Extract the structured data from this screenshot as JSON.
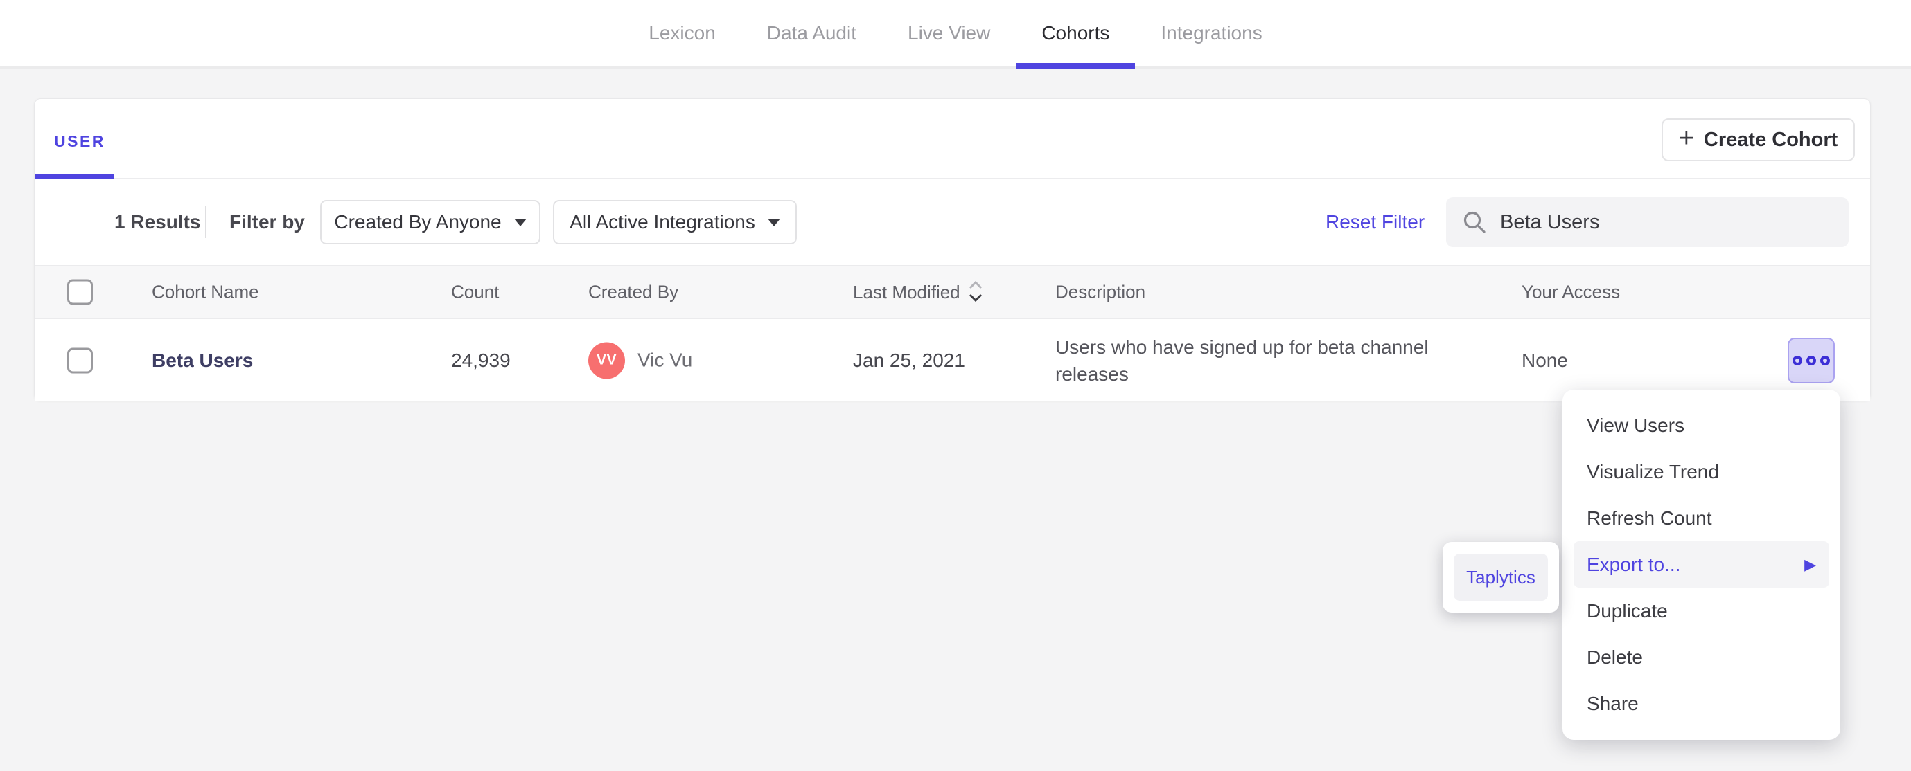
{
  "accent_color": "#4f44e0",
  "nav": {
    "items": [
      {
        "label": "Lexicon",
        "active": false
      },
      {
        "label": "Data Audit",
        "active": false
      },
      {
        "label": "Live View",
        "active": false
      },
      {
        "label": "Cohorts",
        "active": true
      },
      {
        "label": "Integrations",
        "active": false
      }
    ]
  },
  "card": {
    "tab_label": "USER",
    "create_button_label": "Create Cohort",
    "create_button_plus": "+",
    "filters": {
      "results_count": "1 Results",
      "filter_by_label": "Filter by",
      "dropdowns": [
        {
          "label": "Created By Anyone"
        },
        {
          "label": "All Active Integrations"
        }
      ],
      "reset_label": "Reset Filter",
      "search": {
        "icon": "search-icon",
        "value": "Beta Users"
      }
    },
    "table": {
      "columns": [
        "Cohort Name",
        "Count",
        "Created By",
        "Last Modified",
        "Description",
        "Your Access"
      ],
      "sorted_column": "Last Modified",
      "sort_state": "descending",
      "rows": [
        {
          "name": "Beta Users",
          "count": "24,939",
          "created_by": {
            "initials": "VV",
            "name": "Vic Vu",
            "avatar_color": "#f76f6f"
          },
          "last_modified": "Jan 25, 2021",
          "description": "Users who have signed up for beta channel releases",
          "your_access": "None",
          "more_icon": "more-horizontal-icon"
        }
      ]
    }
  },
  "context_menu": {
    "items": [
      {
        "label": "View Users",
        "highlighted": false
      },
      {
        "label": "Visualize Trend",
        "highlighted": false
      },
      {
        "label": "Refresh Count",
        "highlighted": false
      },
      {
        "label": "Export to...",
        "highlighted": true,
        "has_submenu": true,
        "arrow": "▶"
      },
      {
        "label": "Duplicate",
        "highlighted": false
      },
      {
        "label": "Delete",
        "highlighted": false
      },
      {
        "label": "Share",
        "highlighted": false
      }
    ],
    "submenu": {
      "items": [
        {
          "label": "Taplytics",
          "highlighted": true
        }
      ]
    }
  }
}
